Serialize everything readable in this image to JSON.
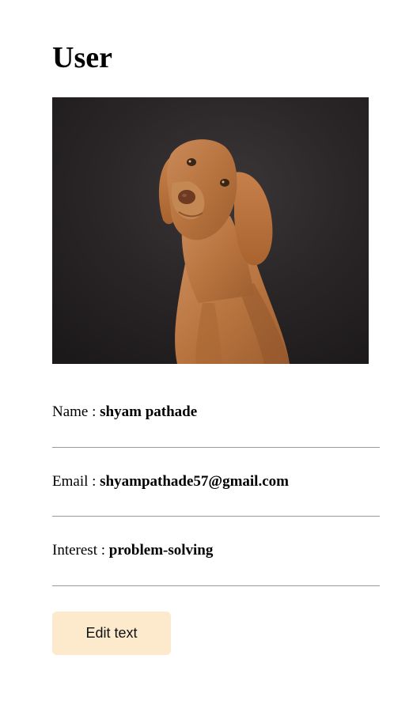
{
  "page": {
    "title": "User"
  },
  "profile": {
    "photo_subject": "dog-photo",
    "fields": [
      {
        "label": "Name : ",
        "value": "shyam pathade"
      },
      {
        "label": "Email : ",
        "value": "shyampathade57@gmail.com"
      },
      {
        "label": "Interest : ",
        "value": "problem-solving"
      }
    ]
  },
  "actions": {
    "edit_label": "Edit text"
  },
  "colors": {
    "background": "#ffffff",
    "divider": "#9a9a9a",
    "button_bg": "#fde9cc"
  }
}
